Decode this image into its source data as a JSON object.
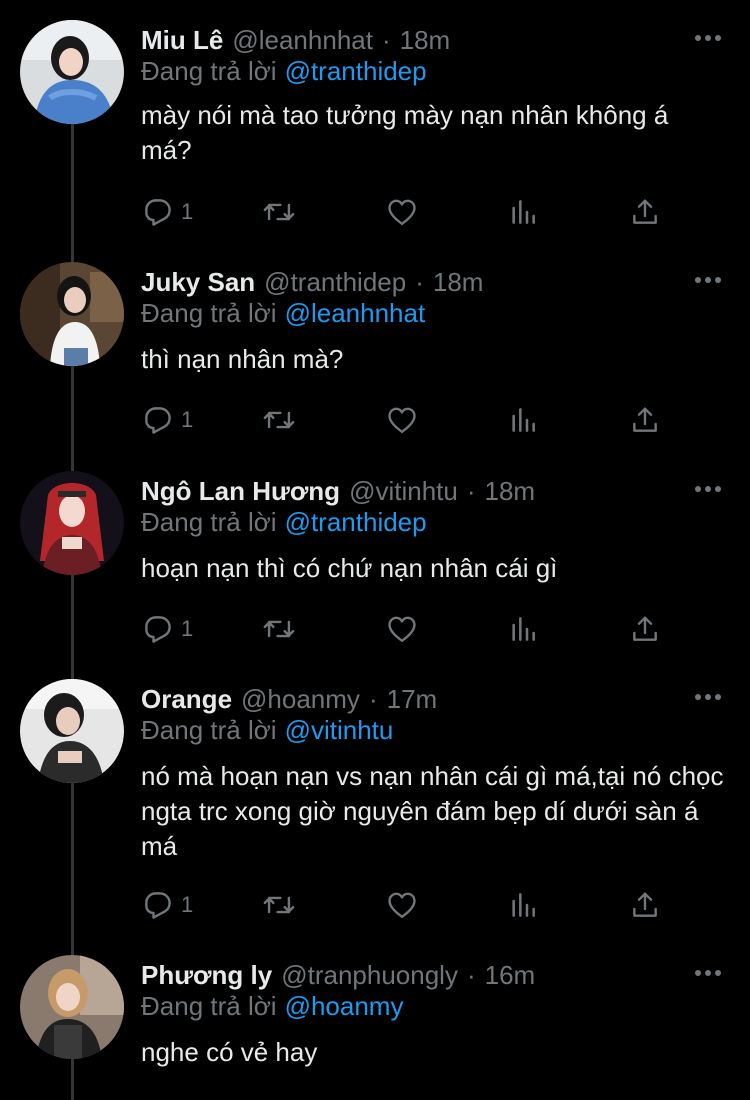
{
  "theme": {
    "background": "#000000",
    "text": "#e7e9ea",
    "secondary": "#71767b",
    "accent": "#1d9bf0"
  },
  "tweets": [
    {
      "name": "Miu Lê",
      "handle": "@leanhnhat",
      "dot": "·",
      "time": "18m",
      "reply_prefix": "Đang trả lời",
      "reply_to": "@tranthidep",
      "text": "mày nói mà tao tưởng mày nạn nhân không á má?",
      "reply_count": "1",
      "avatar_icon": "avatar-photo"
    },
    {
      "name": "Juky San",
      "handle": "@tranthidep",
      "dot": "·",
      "time": "18m",
      "reply_prefix": "Đang trả lời",
      "reply_to": "@leanhnhat",
      "text": "thì nạn nhân mà?",
      "reply_count": "1",
      "avatar_icon": "avatar-photo"
    },
    {
      "name": "Ngô Lan Hương",
      "handle": "@vitinhtu",
      "dot": "·",
      "time": "18m",
      "reply_prefix": "Đang trả lời",
      "reply_to": "@tranthidep",
      "text": "hoạn nạn thì có chứ nạn nhân cái gì",
      "reply_count": "1",
      "avatar_icon": "avatar-photo"
    },
    {
      "name": "Orange",
      "handle": "@hoanmy",
      "dot": "·",
      "time": "17m",
      "reply_prefix": "Đang trả lời",
      "reply_to": "@vitinhtu",
      "text": "nó mà hoạn nạn vs nạn nhân cái gì má,tại nó chọc ngta trc xong giờ nguyên đám bẹp dí dưới sàn á má",
      "reply_count": "1",
      "avatar_icon": "avatar-photo"
    },
    {
      "name": "Phương ly",
      "handle": "@tranphuongly",
      "dot": "·",
      "time": "16m",
      "reply_prefix": "Đang trả lời",
      "reply_to": "@hoanmy",
      "text": "nghe có vẻ hay",
      "avatar_icon": "avatar-photo"
    }
  ],
  "action_icons": [
    "reply-icon",
    "retweet-icon",
    "like-icon",
    "views-icon",
    "share-icon"
  ]
}
